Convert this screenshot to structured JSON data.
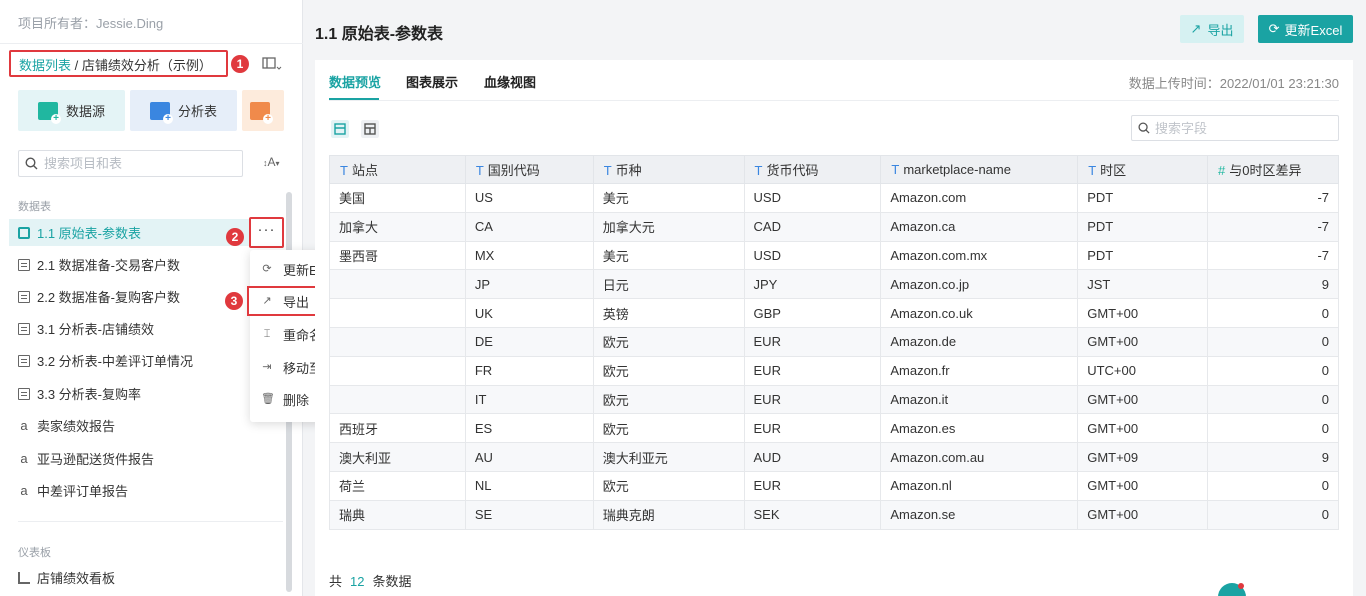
{
  "sidebar": {
    "owner": "项目所有者：Jessie.Ding",
    "breadcrumb": {
      "root": "数据列表",
      "sep": " / ",
      "current": "店铺绩效分析（示例）"
    },
    "quick_buttons": [
      "数据源",
      "分析表"
    ],
    "search_placeholder": "搜索项目和表",
    "sort_label": "A",
    "section_tables": "数据表",
    "items": [
      {
        "label": "1.1 原始表-参数表",
        "icon": "database-icon"
      },
      {
        "label": "2.1 数据准备-交易客户数",
        "icon": "table-doc-icon"
      },
      {
        "label": "2.2 数据准备-复购客户数",
        "icon": "table-doc-icon"
      },
      {
        "label": "3.1 分析表-店铺绩效",
        "icon": "table-doc-icon"
      },
      {
        "label": "3.2 分析表-中差评订单情况",
        "icon": "table-doc-icon"
      },
      {
        "label": "3.3 分析表-复购率",
        "icon": "table-doc-icon"
      },
      {
        "label": "卖家绩效报告",
        "icon": "text-a-icon"
      },
      {
        "label": "亚马逊配送货件报告",
        "icon": "text-a-icon"
      },
      {
        "label": "中差评订单报告",
        "icon": "text-a-icon"
      }
    ],
    "more_label": "···",
    "section_dashboards": "仪表板",
    "dashboard_items": [
      {
        "label": "店铺绩效看板"
      }
    ]
  },
  "badges": [
    "1",
    "2",
    "3"
  ],
  "context_menu": [
    "更新Excel",
    "导出",
    "重命名",
    "移动至",
    "删除"
  ],
  "main": {
    "title": "1.1 原始表-参数表",
    "export_label": "导出",
    "update_label": "更新Excel",
    "tabs": [
      "数据预览",
      "图表展示",
      "血缘视图"
    ],
    "upload_time": "数据上传时间：2022/01/01 23:21:30",
    "field_search_placeholder": "搜索字段",
    "columns": [
      {
        "type": "T",
        "name": "站点"
      },
      {
        "type": "T",
        "name": "国别代码"
      },
      {
        "type": "T",
        "name": "币种"
      },
      {
        "type": "T",
        "name": "货币代码"
      },
      {
        "type": "T",
        "name": "marketplace-name"
      },
      {
        "type": "T",
        "name": "时区"
      },
      {
        "type": "#",
        "name": "与0时区差异"
      }
    ],
    "rows": [
      [
        "美国",
        "US",
        "美元",
        "USD",
        "Amazon.com",
        "PDT",
        "-7"
      ],
      [
        "加拿大",
        "CA",
        "加拿大元",
        "CAD",
        "Amazon.ca",
        "PDT",
        "-7"
      ],
      [
        "墨西哥",
        "MX",
        "美元",
        "USD",
        "Amazon.com.mx",
        "PDT",
        "-7"
      ],
      [
        "",
        "JP",
        "日元",
        "JPY",
        "Amazon.co.jp",
        "JST",
        "9"
      ],
      [
        "",
        "UK",
        "英镑",
        "GBP",
        "Amazon.co.uk",
        "GMT+00",
        "0"
      ],
      [
        "",
        "DE",
        "欧元",
        "EUR",
        "Amazon.de",
        "GMT+00",
        "0"
      ],
      [
        "",
        "FR",
        "欧元",
        "EUR",
        "Amazon.fr",
        "UTC+00",
        "0"
      ],
      [
        "",
        "IT",
        "欧元",
        "EUR",
        "Amazon.it",
        "GMT+00",
        "0"
      ],
      [
        "西班牙",
        "ES",
        "欧元",
        "EUR",
        "Amazon.es",
        "GMT+00",
        "0"
      ],
      [
        "澳大利亚",
        "AU",
        "澳大利亚元",
        "AUD",
        "Amazon.com.au",
        "GMT+09",
        "9"
      ],
      [
        "荷兰",
        "NL",
        "欧元",
        "EUR",
        "Amazon.nl",
        "GMT+00",
        "0"
      ],
      [
        "瑞典",
        "SE",
        "瑞典克朗",
        "SEK",
        "Amazon.se",
        "GMT+00",
        "0"
      ]
    ],
    "footer": {
      "prefix": "共",
      "count": "12",
      "suffix": "条数据"
    }
  },
  "colors": {
    "accent": "#1aa3a3",
    "highlight": "#e0393e"
  }
}
